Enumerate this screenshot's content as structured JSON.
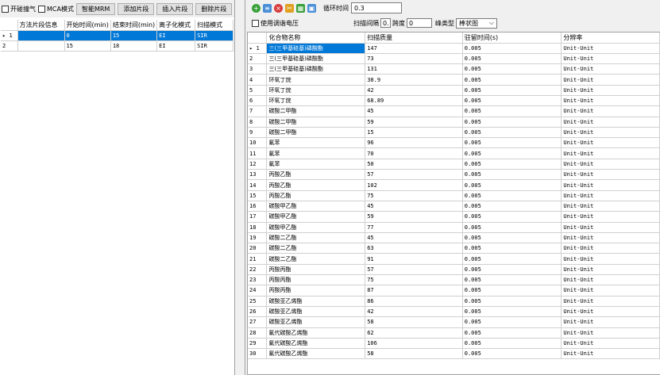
{
  "left": {
    "toolbar": {
      "collision_gas": "开碰撞气",
      "mca_mode": "MCA模式",
      "smart_mrm": "智能MRM",
      "add_segment": "添加片段",
      "insert_segment": "插入片段",
      "delete_segment": "删除片段"
    },
    "columns": [
      "方法片段信息",
      "开始时间(min)",
      "结束时间(min)",
      "离子化模式",
      "扫描模式"
    ],
    "rows": [
      {
        "num": "1",
        "marker": "▸",
        "info": "",
        "start": "0",
        "end": "15",
        "ion": "EI",
        "scan": "SIR"
      },
      {
        "num": "2",
        "marker": "",
        "info": "",
        "start": "15",
        "end": "18",
        "ion": "EI",
        "scan": "SIR"
      }
    ]
  },
  "right": {
    "toolbar": {
      "cycle_label": "循环时间",
      "cycle_value": "0.3"
    },
    "options": {
      "tune_voltage": "使用调谐电压",
      "scan_interval_label": "扫描间隔",
      "scan_interval_value": "0.",
      "span_label": "跨度",
      "span_value": "0",
      "peak_type_label": "峰类型",
      "peak_type_value": "棒状图"
    },
    "columns": [
      "化合物名称",
      "扫描质量",
      "驻留时间(s)",
      "分辨率"
    ],
    "rows": [
      {
        "num": "1",
        "marker": "▸",
        "name": "三(三甲基硅基)磷酸酯",
        "mass": "147",
        "dwell": "0.005",
        "res": "Unit-Unit"
      },
      {
        "num": "2",
        "marker": "",
        "name": "三(三甲基硅基)磷酸酯",
        "mass": "73",
        "dwell": "0.005",
        "res": "Unit-Unit"
      },
      {
        "num": "3",
        "marker": "",
        "name": "三(三甲基硅基)磷酸酯",
        "mass": "131",
        "dwell": "0.005",
        "res": "Unit-Unit"
      },
      {
        "num": "4",
        "marker": "",
        "name": "环氧丁烷",
        "mass": "38.9",
        "dwell": "0.005",
        "res": "Unit-Unit"
      },
      {
        "num": "5",
        "marker": "",
        "name": "环氧丁烷",
        "mass": "42",
        "dwell": "0.005",
        "res": "Unit-Unit"
      },
      {
        "num": "6",
        "marker": "",
        "name": "环氧丁烷",
        "mass": "68.89",
        "dwell": "0.005",
        "res": "Unit-Unit"
      },
      {
        "num": "7",
        "marker": "",
        "name": "碳酸二甲酯",
        "mass": "45",
        "dwell": "0.005",
        "res": "Unit-Unit"
      },
      {
        "num": "8",
        "marker": "",
        "name": "碳酸二甲酯",
        "mass": "59",
        "dwell": "0.005",
        "res": "Unit-Unit"
      },
      {
        "num": "9",
        "marker": "",
        "name": "碳酸二甲酯",
        "mass": "15",
        "dwell": "0.005",
        "res": "Unit-Unit"
      },
      {
        "num": "10",
        "marker": "",
        "name": "氟苯",
        "mass": "96",
        "dwell": "0.005",
        "res": "Unit-Unit"
      },
      {
        "num": "11",
        "marker": "",
        "name": "氟苯",
        "mass": "70",
        "dwell": "0.005",
        "res": "Unit-Unit"
      },
      {
        "num": "12",
        "marker": "",
        "name": "氟苯",
        "mass": "50",
        "dwell": "0.005",
        "res": "Unit-Unit"
      },
      {
        "num": "13",
        "marker": "",
        "name": "丙酸乙酯",
        "mass": "57",
        "dwell": "0.005",
        "res": "Unit-Unit"
      },
      {
        "num": "14",
        "marker": "",
        "name": "丙酸乙酯",
        "mass": "102",
        "dwell": "0.005",
        "res": "Unit-Unit"
      },
      {
        "num": "15",
        "marker": "",
        "name": "丙酸乙酯",
        "mass": "75",
        "dwell": "0.005",
        "res": "Unit-Unit"
      },
      {
        "num": "16",
        "marker": "",
        "name": "碳酸甲乙酯",
        "mass": "45",
        "dwell": "0.005",
        "res": "Unit-Unit"
      },
      {
        "num": "17",
        "marker": "",
        "name": "碳酸甲乙酯",
        "mass": "59",
        "dwell": "0.005",
        "res": "Unit-Unit"
      },
      {
        "num": "18",
        "marker": "",
        "name": "碳酸甲乙酯",
        "mass": "77",
        "dwell": "0.005",
        "res": "Unit-Unit"
      },
      {
        "num": "19",
        "marker": "",
        "name": "碳酸二乙酯",
        "mass": "45",
        "dwell": "0.005",
        "res": "Unit-Unit"
      },
      {
        "num": "20",
        "marker": "",
        "name": "碳酸二乙酯",
        "mass": "63",
        "dwell": "0.005",
        "res": "Unit-Unit"
      },
      {
        "num": "21",
        "marker": "",
        "name": "碳酸二乙酯",
        "mass": "91",
        "dwell": "0.005",
        "res": "Unit-Unit"
      },
      {
        "num": "22",
        "marker": "",
        "name": "丙酸丙酯",
        "mass": "57",
        "dwell": "0.005",
        "res": "Unit-Unit"
      },
      {
        "num": "23",
        "marker": "",
        "name": "丙酸丙酯",
        "mass": "75",
        "dwell": "0.005",
        "res": "Unit-Unit"
      },
      {
        "num": "24",
        "marker": "",
        "name": "丙酸丙酯",
        "mass": "87",
        "dwell": "0.005",
        "res": "Unit-Unit"
      },
      {
        "num": "25",
        "marker": "",
        "name": "碳酸亚乙烯酯",
        "mass": "86",
        "dwell": "0.005",
        "res": "Unit-Unit"
      },
      {
        "num": "26",
        "marker": "",
        "name": "碳酸亚乙烯酯",
        "mass": "42",
        "dwell": "0.005",
        "res": "Unit-Unit"
      },
      {
        "num": "27",
        "marker": "",
        "name": "碳酸亚乙烯酯",
        "mass": "58",
        "dwell": "0.005",
        "res": "Unit-Unit"
      },
      {
        "num": "28",
        "marker": "",
        "name": "氟代碳酸乙烯酯",
        "mass": "62",
        "dwell": "0.005",
        "res": "Unit-Unit"
      },
      {
        "num": "29",
        "marker": "",
        "name": "氟代碳酸乙烯酯",
        "mass": "106",
        "dwell": "0.005",
        "res": "Unit-Unit"
      },
      {
        "num": "30",
        "marker": "",
        "name": "氟代碳酸乙烯酯",
        "mass": "58",
        "dwell": "0.005",
        "res": "Unit-Unit"
      }
    ]
  },
  "colors": {
    "selection": "#0078d7",
    "add_icon": "#3aa13a",
    "delete_icon": "#d83b3b"
  }
}
